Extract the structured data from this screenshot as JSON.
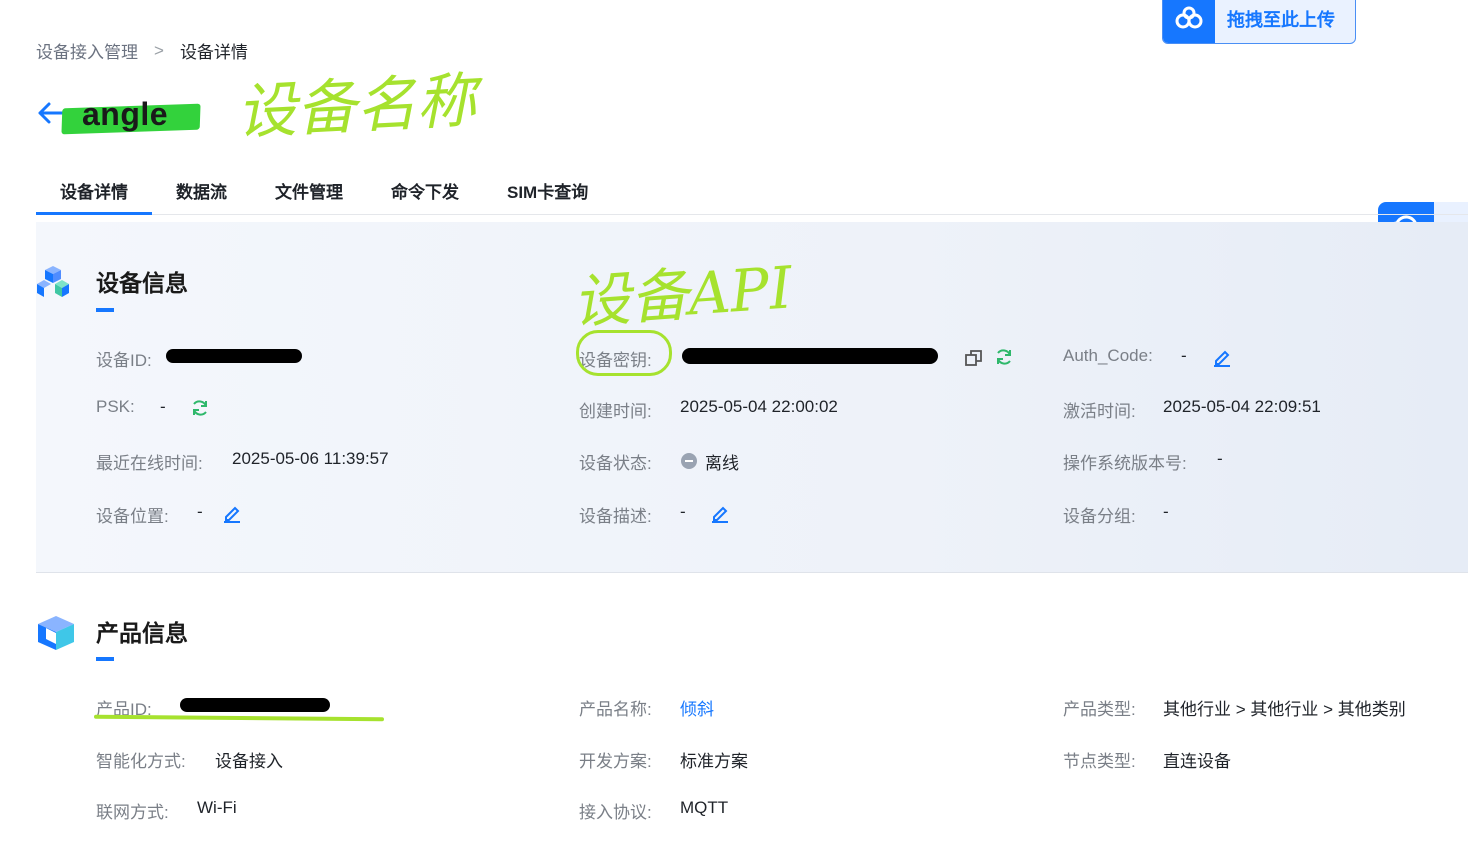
{
  "breadcrumb": {
    "parent": "设备接入管理",
    "separator": ">",
    "current": "设备详情"
  },
  "page": {
    "title": "angle"
  },
  "annotations": {
    "device_name": "设备名称",
    "device_api": "设备API"
  },
  "upload": {
    "label": "拖拽至此上传"
  },
  "tabs": [
    {
      "label": "设备详情",
      "active": true
    },
    {
      "label": "数据流"
    },
    {
      "label": "文件管理"
    },
    {
      "label": "命令下发"
    },
    {
      "label": "SIM卡查询"
    }
  ],
  "device_info": {
    "title": "设备信息",
    "device_id": {
      "label": "设备ID:"
    },
    "device_key": {
      "label": "设备密钥:"
    },
    "auth_code": {
      "label": "Auth_Code:",
      "value": "-"
    },
    "psk": {
      "label": "PSK:",
      "value": "-"
    },
    "created": {
      "label": "创建时间:",
      "value": "2025-05-04 22:00:02"
    },
    "activated": {
      "label": "激活时间:",
      "value": "2025-05-04 22:09:51"
    },
    "last_online": {
      "label": "最近在线时间:",
      "value": "2025-05-06 11:39:57"
    },
    "status": {
      "label": "设备状态:",
      "value": "离线"
    },
    "os_version": {
      "label": "操作系统版本号:",
      "value": "-"
    },
    "location": {
      "label": "设备位置:",
      "value": "-"
    },
    "description": {
      "label": "设备描述:",
      "value": "-"
    },
    "group": {
      "label": "设备分组:",
      "value": "-"
    }
  },
  "product_info": {
    "title": "产品信息",
    "product_id": {
      "label": "产品ID:"
    },
    "product_name": {
      "label": "产品名称:",
      "value": "倾斜"
    },
    "product_type": {
      "label": "产品类型:",
      "value": "其他行业 > 其他行业 > 其他类别"
    },
    "intelligence": {
      "label": "智能化方式:",
      "value": "设备接入"
    },
    "dev_plan": {
      "label": "开发方案:",
      "value": "标准方案"
    },
    "node_type": {
      "label": "节点类型:",
      "value": "直连设备"
    },
    "network": {
      "label": "联网方式:",
      "value": "Wi-Fi"
    },
    "protocol": {
      "label": "接入协议:",
      "value": "MQTT"
    }
  },
  "colors": {
    "accent": "#1677ff",
    "annotation": "#a6e22e",
    "highlight": "#33d23c"
  },
  "icons": [
    "back-arrow-icon",
    "upload-cloud-icon",
    "cubes-icon",
    "box-icon",
    "copy-icon",
    "refresh-icon",
    "edit-icon",
    "offline-status-icon"
  ]
}
